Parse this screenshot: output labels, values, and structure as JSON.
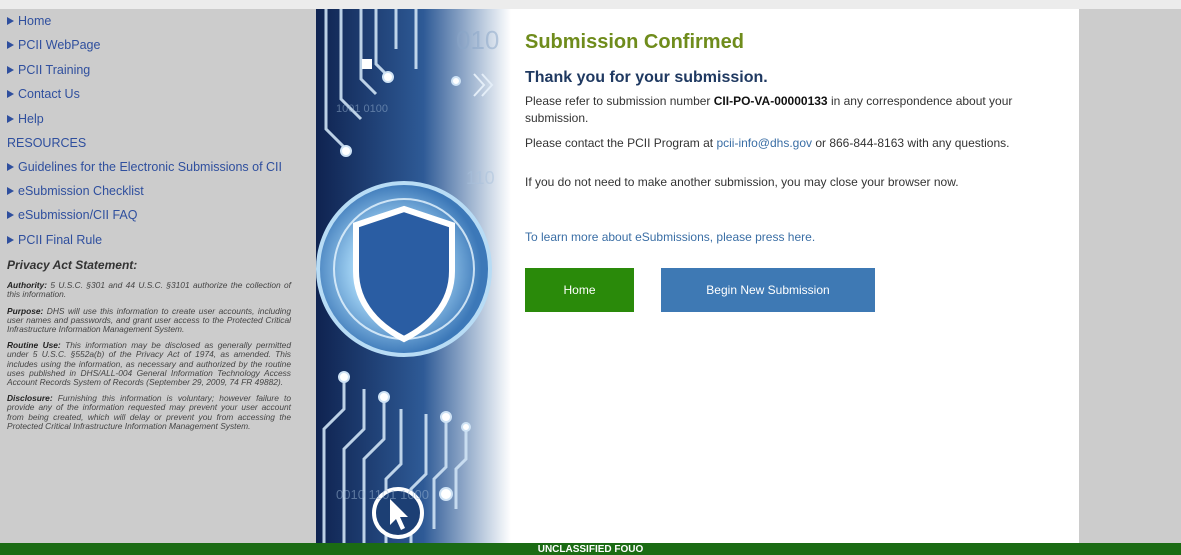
{
  "sidebar": {
    "nav": [
      {
        "label": "Home"
      },
      {
        "label": "PCII WebPage"
      },
      {
        "label": "PCII Training"
      },
      {
        "label": "Contact Us"
      },
      {
        "label": "Help"
      }
    ],
    "resources_heading": "RESOURCES",
    "resources": [
      {
        "label": "Guidelines for the Electronic Submissions of CII"
      },
      {
        "label": "eSubmission Checklist"
      },
      {
        "label": "eSubmission/CII FAQ"
      },
      {
        "label": "PCII Final Rule"
      }
    ],
    "privacy": {
      "heading": "Privacy Act Statement:",
      "authority_label": "Authority:",
      "authority_text": " 5 U.S.C. §301 and 44 U.S.C. §3101 authorize the collection of this information.",
      "purpose_label": "Purpose:",
      "purpose_text": " DHS will use this information to create user accounts, including user names and passwords, and grant user access to the Protected Critical Infrastructure Information Management System.",
      "routine_label": "Routine Use:",
      "routine_text": " This information may be disclosed as generally permitted under 5 U.S.C. §552a(b) of the Privacy Act of 1974, as amended. This includes using the information, as necessary and authorized by the routine uses published in DHS/ALL-004 General Information Technology Access Account Records System of Records (September 29, 2009, 74 FR 49882).",
      "disclosure_label": "Disclosure:",
      "disclosure_text": " Furnishing this information is voluntary; however failure to provide any of the information requested may prevent your user account from being created, which will delay or prevent you from accessing the Protected Critical Infrastructure Information Management System."
    }
  },
  "main": {
    "title": "Submission Confirmed",
    "thanks": "Thank you for your submission.",
    "ref_prefix": "Please refer to submission number ",
    "submission_number": "CII-PO-VA-00000133",
    "ref_suffix": " in any correspondence about your submission.",
    "contact_prefix": "Please contact the PCII Program at ",
    "contact_email": "pcii-info@dhs.gov",
    "contact_suffix": " or 866-844-8163 with any questions.",
    "close_text": "If you do not need to make another submission, you may close your browser now.",
    "learn_more": "To learn more about eSubmissions, please press here.",
    "home_button": "Home",
    "new_button": "Begin New Submission"
  },
  "art": {
    "bits_top": "010",
    "bits_mid": "110",
    "bits_small": "1001 0100",
    "bits_bottom": "0010 1101 1000"
  },
  "footer": {
    "classification": "UNCLASSIFIED FOUO"
  },
  "colors": {
    "title_green": "#6f8c1c",
    "heading_navy": "#1f3961",
    "link_blue": "#3a6ea5",
    "home_button": "#2a8a0a",
    "new_button": "#3e79b4",
    "footer_green": "#1b6b14"
  }
}
